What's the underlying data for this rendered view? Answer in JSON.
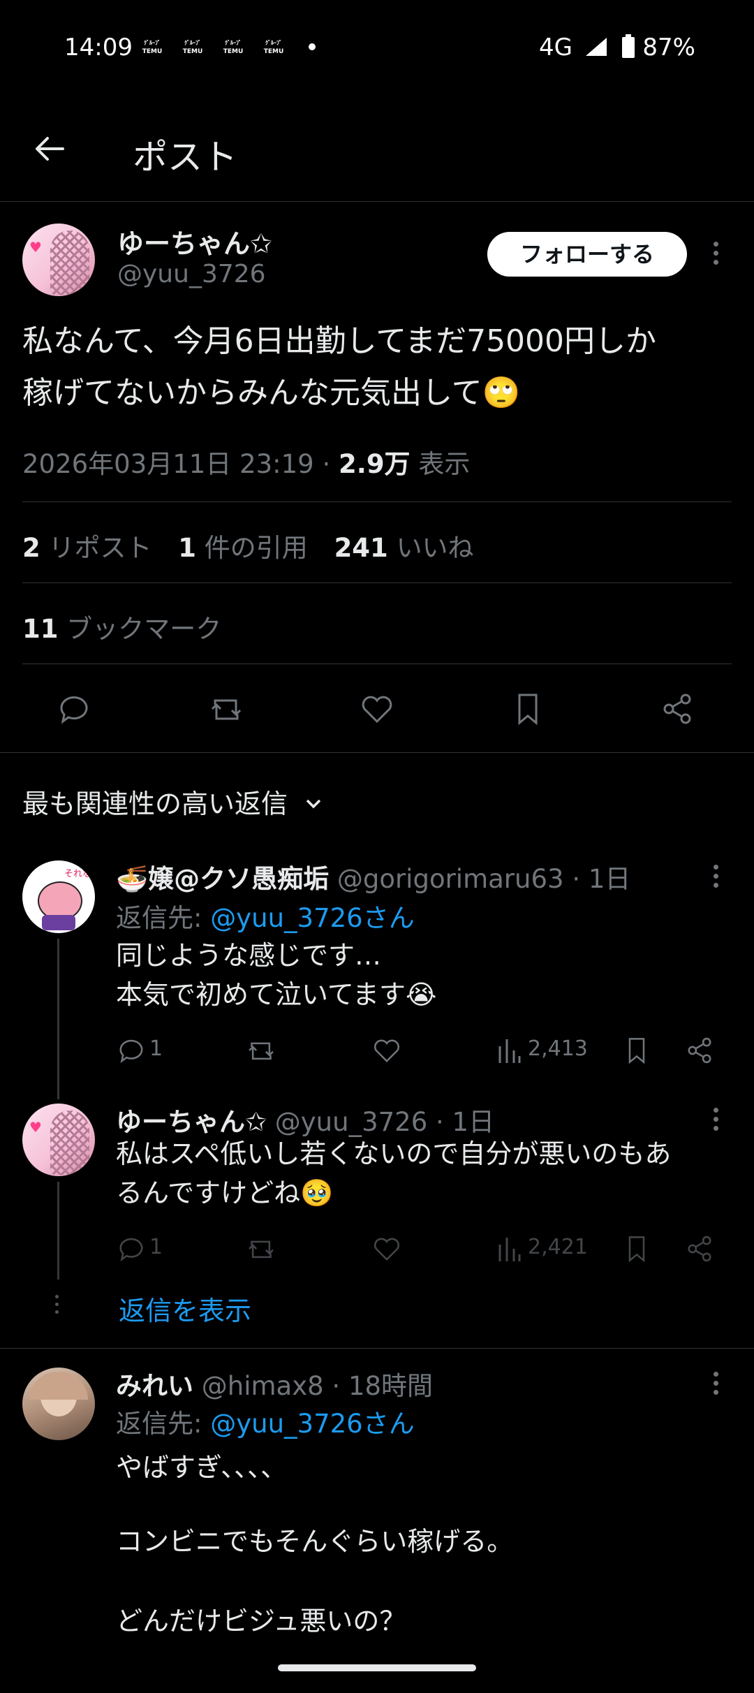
{
  "status_bar": {
    "time": "14:09",
    "temu_badges": [
      "TEMU",
      "TEMU",
      "TEMU",
      "TEMU"
    ],
    "network": "4G",
    "battery": "87%"
  },
  "header": {
    "title": "ポスト"
  },
  "post": {
    "display_name": "ゆーちゃん✩",
    "handle": "@yuu_3726",
    "follow_label": "フォローする",
    "text_line1": "私なんて、今月6日出勤してまだ75000円しか",
    "text_line2": "稼げてないからみんな元気出して🙄",
    "timestamp": "2026年03月11日 23:19 ·",
    "views_count": "2.9万",
    "views_label": "表示",
    "reposts_count": "2",
    "reposts_label": "リポスト",
    "quotes_count": "1",
    "quotes_label": "件の引用",
    "likes_count": "241",
    "likes_label": "いいね",
    "bookmarks_count": "11",
    "bookmarks_label": "ブックマーク"
  },
  "replies_sort": {
    "label": "最も関連性の高い返信"
  },
  "replies": [
    {
      "name": "🍜嬢@クソ愚痴垢",
      "handle": "@gorigorimaru63",
      "time": "· 1日",
      "reply_to_prefix": "返信先:",
      "reply_to_handle": "@yuu_3726さん",
      "text_line1": "同じような感じです…",
      "text_line2": "本気で初めて泣いてます😭",
      "reply_count": "1",
      "views": "2,413"
    },
    {
      "name": "ゆーちゃん✩",
      "handle": "@yuu_3726",
      "time": "· 1日",
      "text_line1": "私はスペ低いし若くないので自分が悪いのもあ",
      "text_line2": "るんですけどね🥹",
      "reply_count": "1",
      "views": "2,421"
    },
    {
      "name": "みれい",
      "handle": "@himax8",
      "time": "· 18時間",
      "reply_to_prefix": "返信先:",
      "reply_to_handle": "@yuu_3726さん",
      "text_line1": "やばすぎ、、、、",
      "text_line2": "コンビニでもそんぐらい稼げる。",
      "text_line3": "どんだけビジュ悪いの？"
    }
  ],
  "show_replies": {
    "label": "返信を表示"
  },
  "colors": {
    "accent": "#1d9bf0",
    "background": "#000000",
    "muted": "#71767b",
    "text": "#e7e9ea"
  }
}
